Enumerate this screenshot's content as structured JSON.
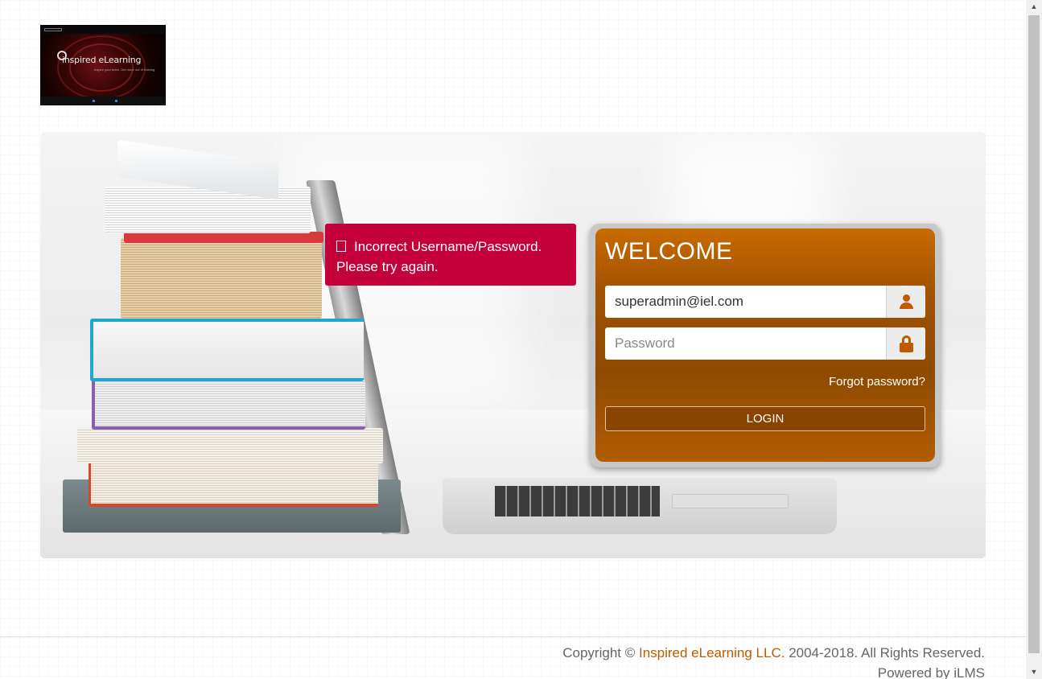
{
  "logo": {
    "brand_text": "inspired eLearning",
    "tagline": "Inspire your team. Get more out of training"
  },
  "error": {
    "icon": "alert-icon",
    "message": "Incorrect Username/Password. Please try again."
  },
  "login": {
    "title": "WELCOME",
    "username_value": "superadmin@iel.com",
    "username_icon": "user-icon",
    "password_placeholder": "Password",
    "password_icon": "lock-icon",
    "forgot_label": "Forgot password?",
    "login_label": "LOGIN"
  },
  "footer": {
    "copyright_prefix": "Copyright ©",
    "company_link": "Inspired eLearning LLC.",
    "copyright_suffix": "2004-2018. All Rights Reserved.",
    "powered_by": "Powered by iLMS"
  },
  "colors": {
    "accent": "#c05a00",
    "card_dark": "#8f4a00",
    "error_bg": "#c4003a"
  }
}
